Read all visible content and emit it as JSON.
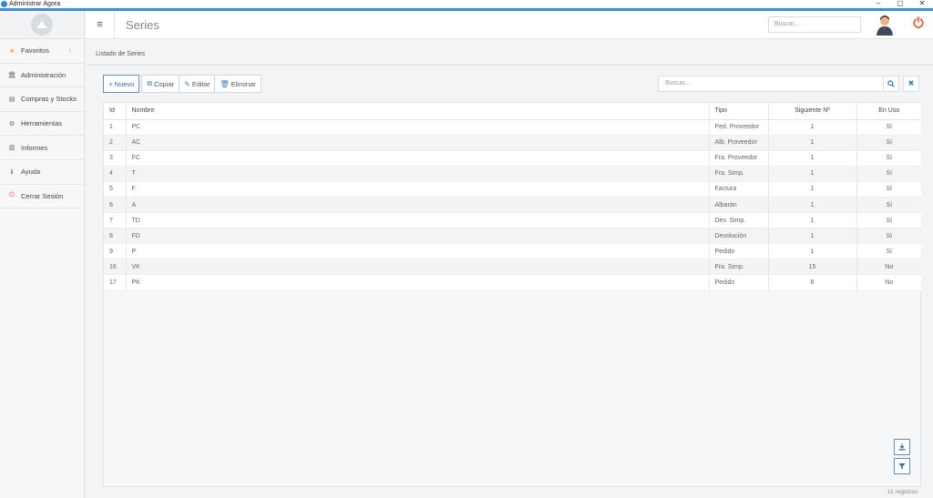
{
  "window": {
    "title": "Administrar Ágora",
    "minimize": "–",
    "maximize": "▢",
    "close": "✕"
  },
  "sidebar": {
    "items": [
      {
        "label": "Favoritos",
        "icon": "★"
      },
      {
        "label": "Administración",
        "icon": "🏛"
      },
      {
        "label": "Compras y Stocks",
        "icon": "▤"
      },
      {
        "label": "Herramientas",
        "icon": "⚙"
      },
      {
        "label": "Informes",
        "icon": "▥"
      },
      {
        "label": "Ayuda",
        "icon": "ℹ"
      },
      {
        "label": "Cerrar Sesión",
        "icon": "⏻"
      }
    ],
    "favoritos_chevron": "‹"
  },
  "header": {
    "menu_icon": "≡",
    "title": "Series",
    "search_placeholder": "Buscar..."
  },
  "content": {
    "section_title": "Listado de Series"
  },
  "toolbar": {
    "new": "Nuevo",
    "copy": "Copiar",
    "edit": "Editar",
    "delete": "Eliminar"
  },
  "grid_search": {
    "placeholder": "Buscar...",
    "search_icon": "🔍",
    "clear_icon": "✖"
  },
  "table": {
    "columns": [
      "Id",
      "Nombre",
      "Tipo",
      "Siguiente Nº",
      "En Uso"
    ],
    "rows": [
      [
        "1",
        "PC",
        "Ped. Proveedor",
        "1",
        "Sí"
      ],
      [
        "2",
        "AC",
        "Alb. Proveedor",
        "1",
        "Sí"
      ],
      [
        "3",
        "FC",
        "Fra. Proveedor",
        "1",
        "Sí"
      ],
      [
        "4",
        "T",
        "Fra. Simp.",
        "1",
        "Sí"
      ],
      [
        "5",
        "F",
        "Factura",
        "1",
        "Sí"
      ],
      [
        "6",
        "A",
        "Albarán",
        "1",
        "Sí"
      ],
      [
        "7",
        "TD",
        "Dev. Simp.",
        "1",
        "Sí"
      ],
      [
        "8",
        "FD",
        "Devolución",
        "1",
        "Sí"
      ],
      [
        "9",
        "P",
        "Pedido",
        "1",
        "Sí"
      ],
      [
        "16",
        "VK",
        "Fra. Simp.",
        "15",
        "No"
      ],
      [
        "17",
        "PK",
        "Pedido",
        "6",
        "No"
      ]
    ]
  },
  "footer": {
    "count": "11 registros"
  },
  "colors": {
    "accent": "#3c8ce0",
    "power": "#e8542c",
    "star": "#f0ad1e"
  }
}
